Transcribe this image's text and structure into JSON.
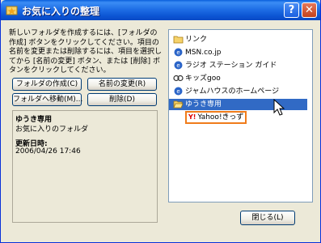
{
  "window": {
    "title": "お気に入りの整理",
    "help_glyph": "?",
    "close_glyph": "✕"
  },
  "description": "新しいフォルダを作成するには、[フォルダの作成] ボタンをクリックしてください。項目の名前を変更または削除するには、項目を選択してから [名前の変更] ボタン、または [削除] ボタンをクリックしてください。",
  "buttons": {
    "create_folder": "フォルダの作成(C)",
    "rename": "名前の変更(R)",
    "move_to_folder": "フォルダへ移動(M)...",
    "delete": "削除(D)",
    "close": "閉じる(L)"
  },
  "info": {
    "name": "ゆうき専用",
    "type": "お気に入りのフォルダ",
    "modified_label": "更新日時:",
    "modified_value": "2006/04/26 17:46"
  },
  "favorites": [
    {
      "label": "リンク",
      "icon": "folder-icon"
    },
    {
      "label": "MSN.co.jp",
      "icon": "msn-icon"
    },
    {
      "label": "ラジオ ステーション ガイド",
      "icon": "ie-icon"
    },
    {
      "label": "キッズgoo",
      "icon": "goo-icon"
    },
    {
      "label": "ジャムハウスのホームページ",
      "icon": "ie-icon"
    },
    {
      "label": "ゆうき専用",
      "icon": "folder-open-icon",
      "selected": true
    }
  ],
  "subitem": {
    "label": "Yahoo!きっず",
    "logo": "Y!",
    "icon": "yahoo-kids-icon"
  },
  "colors": {
    "titlebar": "#0a5fdc",
    "selection": "#316ac5",
    "highlight_border": "#f07c1b",
    "dialog_bg": "#ece9d8"
  }
}
